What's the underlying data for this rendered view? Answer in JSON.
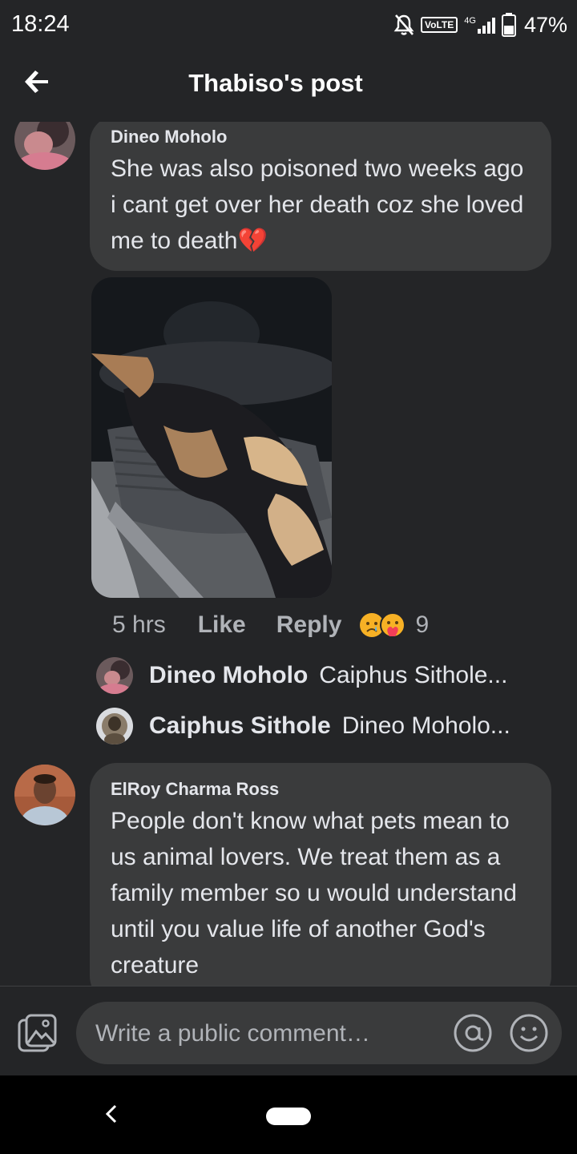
{
  "status_bar": {
    "time": "18:24",
    "network": "VoLTE",
    "signal": "4G",
    "battery": "47%"
  },
  "header": {
    "title": "Thabiso's post",
    "back_icon": "arrow-left-icon"
  },
  "comment1": {
    "author": "Dineo Moholo",
    "text": "She was  also poisoned two weeks ago i cant get over her death coz she loved me to death💔",
    "time": "5 hrs",
    "like_label": "Like",
    "reply_label": "Reply",
    "reaction_count": "9",
    "reaction_icons": [
      "sad-face-icon",
      "care-face-icon"
    ]
  },
  "replies": [
    {
      "author": "Dineo Moholo",
      "text": "Caiphus Sithole..."
    },
    {
      "author": "Caiphus Sithole",
      "text": "Dineo Moholo..."
    }
  ],
  "comment2": {
    "author": "ElRoy Charma Ross",
    "text": "People don't know what pets mean to us animal lovers. We treat them as a family member so u would understand until you value life of another God's creature"
  },
  "composer": {
    "placeholder": "Write a public comment…"
  },
  "colors": {
    "background": "#242527",
    "bubble": "#3a3b3c",
    "text": "#e4e6eb",
    "muted": "#b0b3b8"
  }
}
